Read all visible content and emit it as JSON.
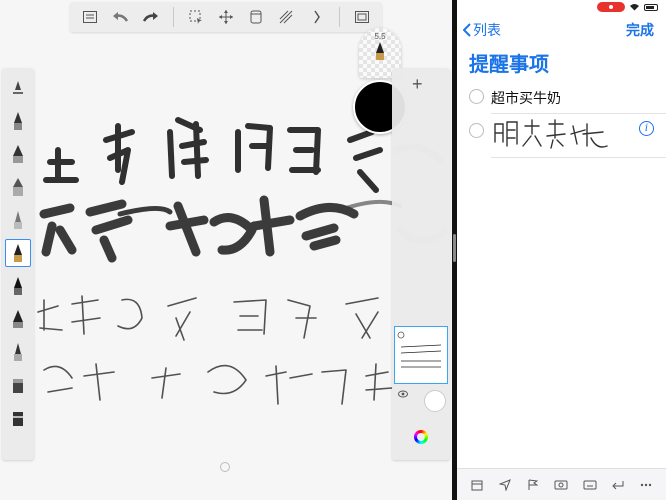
{
  "sketch": {
    "brush_size": "5.5",
    "toolbar_icons": [
      "gallery-icon",
      "undo-icon",
      "redo-icon",
      "select-icon",
      "transform-icon",
      "ruler-icon",
      "perspective-icon",
      "symmetry-icon",
      "fullscreen-icon"
    ],
    "add_layer": "+"
  },
  "reminders": {
    "back_label": "列表",
    "done_label": "完成",
    "title": "提醒事项",
    "items": [
      {
        "text": "超市买牛奶"
      },
      {
        "text": "",
        "handwritten": "明天去烧"
      }
    ],
    "info_label": "i",
    "accent": "#1a73e8"
  }
}
